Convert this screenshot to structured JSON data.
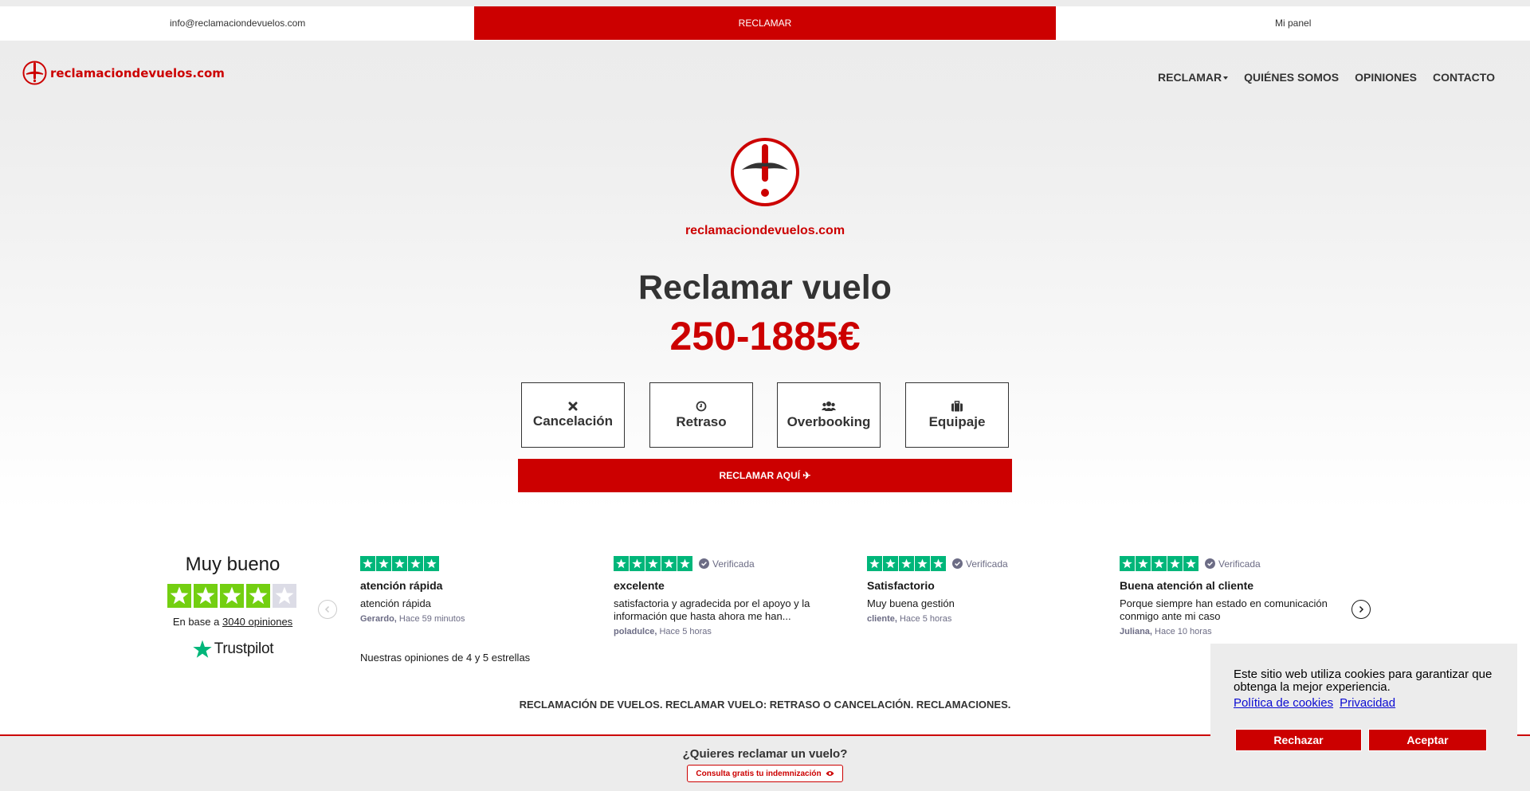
{
  "topbar": {
    "email": "info@reclamaciondevuelos.com",
    "claim_label": "RECLAMAR",
    "panel_label": "Mi panel"
  },
  "brand": {
    "name": "reclamaciondevuelos.com",
    "color": "#cc0000"
  },
  "nav": {
    "items": [
      {
        "label": "RECLAMAR",
        "has_dropdown": true
      },
      {
        "label": "QUIÉNES SOMOS"
      },
      {
        "label": "OPINIONES"
      },
      {
        "label": "CONTACTO"
      }
    ]
  },
  "hero": {
    "brand_text": "reclamaciondevuelos.com",
    "title": "Reclamar vuelo",
    "price": "250-1885€",
    "types": [
      {
        "label": "Cancelación",
        "icon": "close-icon"
      },
      {
        "label": "Retraso",
        "icon": "clock-icon"
      },
      {
        "label": "Overbooking",
        "icon": "users-icon"
      },
      {
        "label": "Equipaje",
        "icon": "suitcase-icon"
      }
    ],
    "cta_label": "RECLAMAR AQUÍ ✈"
  },
  "trustpilot": {
    "rating_text": "Muy bueno",
    "stars": 4,
    "count_prefix": "En base a",
    "count_link": "3040 opiniones",
    "logo_text": "Trustpilot",
    "footnote": "Nuestras opiniones de 4 y 5 estrellas",
    "colors": {
      "green": "#00b67a",
      "four_star": "#73cf11",
      "empty": "#dcdce6"
    },
    "reviews": [
      {
        "stars": 5,
        "verified": false,
        "title": "atención rápida",
        "text": "atención rápida",
        "author": "Gerardo,",
        "time": "Hace 59 minutos"
      },
      {
        "stars": 5,
        "verified": true,
        "verified_label": "Verificada",
        "title": "excelente",
        "text": "satisfactoria y agradecida por el apoyo y la información que hasta ahora me han...",
        "author": "poladulce,",
        "time": "Hace 5 horas"
      },
      {
        "stars": 5,
        "verified": true,
        "verified_label": "Verificada",
        "title": "Satisfactorio",
        "text": "Muy buena gestión",
        "author": "cliente,",
        "time": "Hace 5 horas"
      },
      {
        "stars": 5,
        "verified": true,
        "verified_label": "Verificada",
        "title": "Buena atención al cliente",
        "text": "Porque siempre han estado en comunicación conmigo ante mi caso",
        "author": "Juliana,",
        "time": "Hace 10 horas"
      }
    ]
  },
  "seo_line": "RECLAMACIÓN DE VUELOS. RECLAMAR VUELO: RETRASO O CANCELACIÓN. RECLAMACIONES.",
  "bottom_bar": {
    "question": "¿Quieres reclamar un vuelo?",
    "button_label": "Consulta gratis tu indemnización"
  },
  "cookie": {
    "text": "Este sitio web utiliza cookies para garantizar que obtenga la mejor experiencia.",
    "link_cookies": "Política de cookies",
    "link_privacy": "Privacidad",
    "reject_label": "Rechazar",
    "accept_label": "Aceptar"
  }
}
